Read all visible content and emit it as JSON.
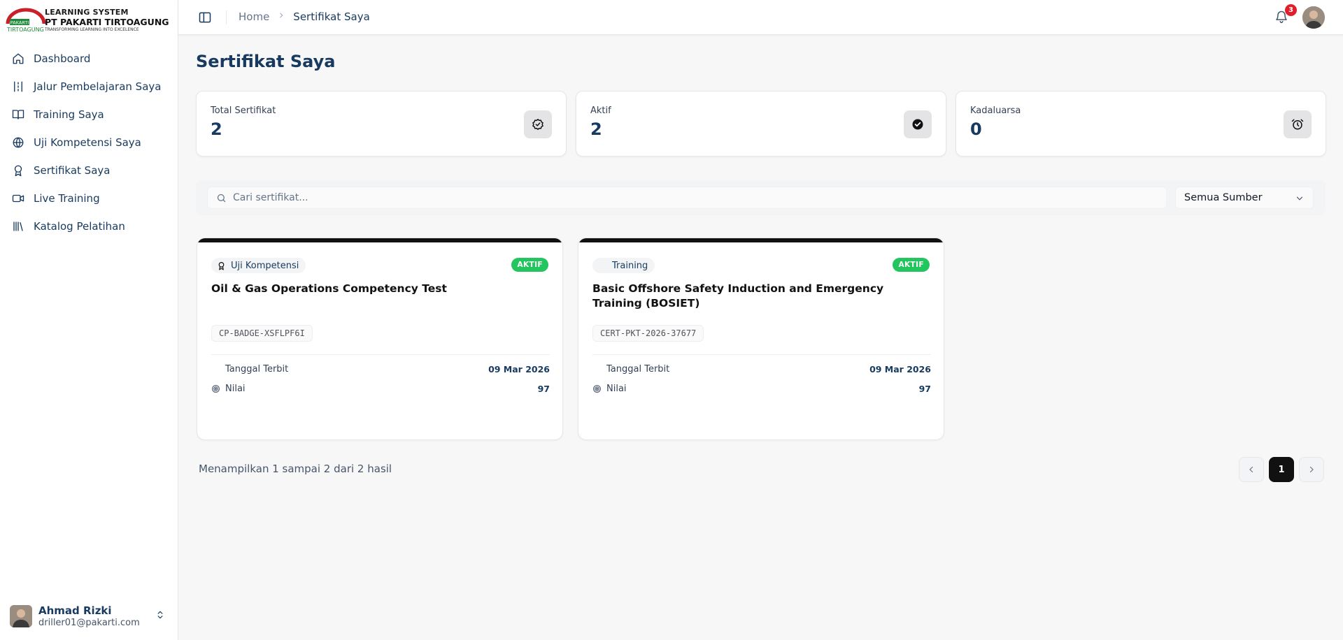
{
  "brand": {
    "line1": "LEARNING SYSTEM",
    "line2": "PT PAKARTI TIRTOAGUNG",
    "line3": "TRANSFORMING LEARNING INTO EXCELENCE",
    "mark_top": "PAKARTI",
    "mark_bottom": "TIRTOAGUNG",
    "colors": {
      "red": "#c9202a",
      "green": "#1f8a3b"
    }
  },
  "sidebar": {
    "items": [
      {
        "label": "Dashboard",
        "icon": "home-icon"
      },
      {
        "label": "Jalur Pembelajaran Saya",
        "icon": "route-icon"
      },
      {
        "label": "Training Saya",
        "icon": "book-open-icon"
      },
      {
        "label": "Uji Kompetensi Saya",
        "icon": "globe-icon"
      },
      {
        "label": "Sertifikat Saya",
        "icon": "award-icon"
      },
      {
        "label": "Live Training",
        "icon": "video-icon"
      },
      {
        "label": "Katalog Pelatihan",
        "icon": "library-icon"
      }
    ]
  },
  "user": {
    "name": "Ahmad Rizki",
    "email": "driller01@pakarti.com"
  },
  "topbar": {
    "breadcrumb_home": "Home",
    "breadcrumb_current": "Sertifikat Saya",
    "notification_count": "3"
  },
  "page": {
    "title": "Sertifikat Saya"
  },
  "stats": [
    {
      "label": "Total Sertifikat",
      "value": "2",
      "icon": "badge-check-icon"
    },
    {
      "label": "Aktif",
      "value": "2",
      "icon": "check-circle-icon"
    },
    {
      "label": "Kadaluarsa",
      "value": "0",
      "icon": "alarm-clock-icon"
    }
  ],
  "filters": {
    "search_placeholder": "Cari sertifikat...",
    "source_selected": "Semua Sumber"
  },
  "certificates": [
    {
      "type": "Uji Kompetensi",
      "status": "AKTIF",
      "title": "Oil & Gas Operations Competency Test",
      "code": "CP-BADGE-XSFLPF6I",
      "issued_label": "Tanggal Terbit",
      "issued_value": "09 Mar 2026",
      "score_label": "Nilai",
      "score_value": "97"
    },
    {
      "type": "Training",
      "status": "AKTIF",
      "title": "Basic Offshore Safety Induction and Emergency Training (BOSIET)",
      "code": "CERT-PKT-2026-37677",
      "issued_label": "Tanggal Terbit",
      "issued_value": "09 Mar 2026",
      "score_label": "Nilai",
      "score_value": "97"
    }
  ],
  "pagination": {
    "summary": "Menampilkan 1 sampai 2 dari 2 hasil",
    "current_page": "1"
  },
  "colors": {
    "primary": "#173a5e",
    "status_active": "#22c55e",
    "notification": "#e11d2a"
  }
}
